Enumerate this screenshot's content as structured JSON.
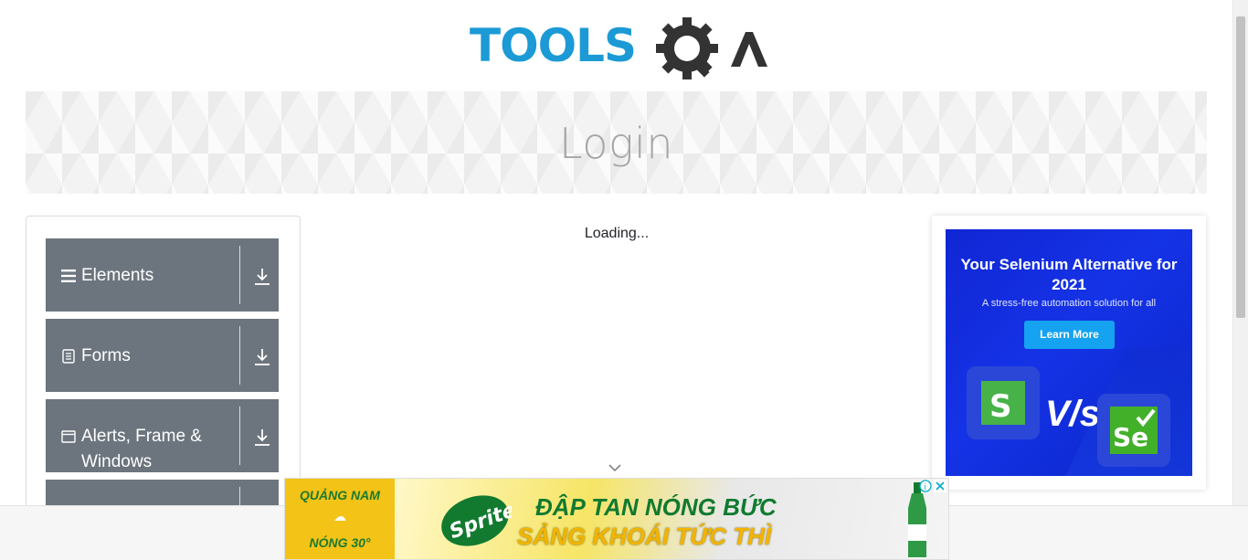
{
  "header": {
    "logo_text": "TOOLSQA"
  },
  "banner": {
    "title": "Login"
  },
  "sidebar": {
    "groups": [
      {
        "label": "Elements",
        "icon": "list-icon"
      },
      {
        "label": "Forms",
        "icon": "document-icon"
      },
      {
        "label": "Alerts, Frame & Windows",
        "icon": "window-icon"
      },
      {
        "label": "",
        "icon": ""
      }
    ]
  },
  "main": {
    "loading_text": "Loading..."
  },
  "right_ad": {
    "title": "Your Selenium Alternative for 2021",
    "subtitle": "A stress-free automation solution for all",
    "button_label": "Learn More",
    "vs_text": "V/s"
  },
  "bottom_ad": {
    "city": "QUẢNG NAM",
    "temperature": "NÓNG 30°",
    "headline_1": "ĐẬP TAN NÓNG BỨC",
    "headline_2": "SẢNG KHOÁI TỨC THÌ",
    "brand": "Sprite"
  },
  "colors": {
    "accent_blue": "#1b9ad6",
    "logo_gray": "#333333",
    "sidebar_group_bg": "#6c757d",
    "ad_blue": "#1533e6",
    "ad_button": "#15a2f0",
    "sprite_green": "#117a2f",
    "sprite_yellow": "#f2b400"
  }
}
